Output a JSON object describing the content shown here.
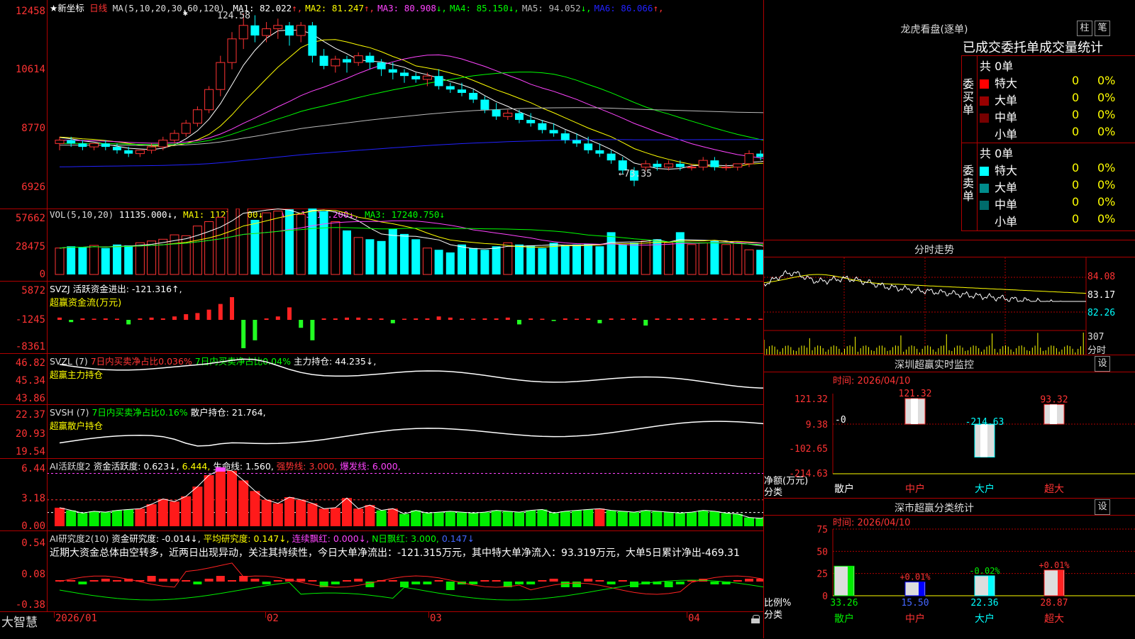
{
  "main": {
    "title": "★新坐标",
    "period": "日线",
    "ma_header": "MA(5,10,20,30,60,120)",
    "ma": [
      {
        "label": "MA1:",
        "value": "82.022",
        "arrow": "↑",
        "color": "#ffffff"
      },
      {
        "label": "MA2:",
        "value": "81.247",
        "arrow": "↑",
        "color": "#ffff00"
      },
      {
        "label": "MA3:",
        "value": "80.908",
        "arrow": "↓",
        "color": "#ff44ff"
      },
      {
        "label": "MA4:",
        "value": "85.150",
        "arrow": "↓",
        "color": "#00ff00"
      },
      {
        "label": "MA5:",
        "value": "94.052",
        "arrow": "↓",
        "color": "#bbbbbb"
      },
      {
        "label": "MA6:",
        "value": "86.066",
        "arrow": "↑",
        "color": "#2222ff"
      }
    ],
    "y_labels": [
      "12458",
      "10614",
      "8770",
      "6926"
    ],
    "high_label": "124.58",
    "low_label": "←73.35",
    "high_marker": "✱"
  },
  "vol": {
    "header": "VOL(5,10,20)",
    "value": "11135.000↓",
    "ma1": "MA1: 11275.600↓",
    "ma2": "MA2: 13115.200↓",
    "ma3": "MA3: 17240.750↓",
    "y_labels": [
      "57662",
      "28475",
      "0"
    ]
  },
  "svzj": {
    "header": "SVZJ  活跃资金进出: -121.316↑,",
    "sub": "超赢资金流(万元)",
    "y_labels": [
      "5872",
      "-1245",
      "-8361"
    ]
  },
  "svzl": {
    "header": "SVZL  (7)",
    "t1": "7日内买卖净占比0.036%",
    "t2": "7日内买卖净占比0.04%",
    "t3": "主力持仓: 44.235↓,",
    "sub": "超赢主力持仓",
    "y_labels": [
      "46.82",
      "45.34",
      "43.86"
    ]
  },
  "svsh": {
    "header": "SVSH  (7)",
    "t1": "7日内买卖净占比0.16%",
    "t2": "散户持仓: 21.764,",
    "sub": "超赢散户持仓",
    "y_labels": [
      "22.37",
      "20.93",
      "19.54"
    ]
  },
  "ai1": {
    "header": "AI活跃度2",
    "t1": "资金活跃度: 0.623↓,",
    "t2": "6.444,",
    "t3": "生命线: 1.560,",
    "t4": "强势线: 3.000,",
    "t5": "爆发线: 6.000,",
    "y_labels": [
      "6.44",
      "3.18",
      "0.00"
    ]
  },
  "ai2": {
    "header": "AI研究度2(10)",
    "t1": "资金研究度: -0.014↓,",
    "t2": "平均研究度: 0.147↓,",
    "t3": "连续飘红: 0.000↓,",
    "t4": "N日飘红: 3.000,",
    "t5": "0.147↓",
    "comment": "近期大资金总体由空转多，近两日出现异动，关注其持续性，今日大单净流出：-121.315万元，其中特大单净流入：93.319万元，大单5日累计净出-469.31",
    "y_labels": [
      "0.54",
      "0.08",
      "-0.38"
    ]
  },
  "xaxis": {
    "brand": "大智慧",
    "labels": [
      "2026/01",
      "02",
      "03",
      "04"
    ]
  },
  "dragon": {
    "title": "龙虎看盘(逐单)",
    "btn1": "柱",
    "btn2": "笔",
    "tabs": "已成交委托单成交量统计",
    "buy_label": "委买单",
    "sell_label": "委卖单",
    "buy_total": "共 0单",
    "sell_total": "共 0单",
    "buy_rows": [
      {
        "name": "特大",
        "color": "#ff0000",
        "count": "0",
        "pct": "0%"
      },
      {
        "name": "大单",
        "color": "#990000",
        "count": "0",
        "pct": "0%"
      },
      {
        "name": "中单",
        "color": "#770000",
        "count": "0",
        "pct": "0%"
      },
      {
        "name": "小单",
        "color": "#000000",
        "count": "0",
        "pct": "0%"
      }
    ],
    "sell_rows": [
      {
        "name": "特大",
        "color": "#00ffff",
        "count": "0",
        "pct": "0%"
      },
      {
        "name": "大单",
        "color": "#008b8b",
        "count": "0",
        "pct": "0%"
      },
      {
        "name": "中单",
        "color": "#006b6b",
        "count": "0",
        "pct": "0%"
      },
      {
        "name": "小单",
        "color": "#000000",
        "count": "0",
        "pct": "0%"
      }
    ]
  },
  "intraday": {
    "title": "分时走势",
    "y_labels": [
      "84.08",
      "83.17",
      "82.26"
    ],
    "vol_label": "307",
    "vol_unit": "分时"
  },
  "monitor": {
    "title": "深圳超赢实时监控",
    "btn": "设",
    "time": "时间: 2026/04/10",
    "y_labels": [
      "121.32",
      "9.38",
      "-102.65",
      "-214.63"
    ],
    "unit1": "净额(万元)",
    "unit2": "分类",
    "zero": "-0",
    "categories": [
      "散户",
      "中户",
      "大户",
      "超大"
    ],
    "values": [
      0,
      121.32,
      -214.63,
      93.32
    ],
    "value_labels": [
      "",
      "121.32",
      "-214.63",
      "93.32"
    ]
  },
  "classify": {
    "title": "深市超赢分类统计",
    "btn": "设",
    "time": "时间: 2026/04/10",
    "y_labels": [
      "75",
      "50",
      "25",
      "0"
    ],
    "unit1": "比例%",
    "unit2": "分类",
    "categories": [
      "散户",
      "中户",
      "大户",
      "超大"
    ],
    "values": [
      33.26,
      15.5,
      22.36,
      28.87
    ],
    "changes": [
      "",
      "+0.01%",
      "-0.02%",
      "+0.01%"
    ]
  },
  "chart_data": {
    "type": "candlestick",
    "title": "★新坐标 日线",
    "y_axis": [
      69.26,
      124.58
    ],
    "candles": [
      [
        86,
        88,
        84,
        87
      ],
      [
        87,
        88,
        85,
        86
      ],
      [
        86,
        87,
        84,
        85
      ],
      [
        85,
        86,
        84,
        86
      ],
      [
        86,
        87,
        84,
        85
      ],
      [
        85,
        86,
        83,
        84
      ],
      [
        84,
        85,
        82,
        83
      ],
      [
        83,
        84,
        82,
        84
      ],
      [
        84,
        86,
        83,
        85
      ],
      [
        85,
        88,
        84,
        87
      ],
      [
        87,
        90,
        86,
        89
      ],
      [
        89,
        93,
        88,
        92
      ],
      [
        92,
        97,
        91,
        96
      ],
      [
        96,
        103,
        95,
        102
      ],
      [
        102,
        112,
        100,
        110
      ],
      [
        110,
        119,
        108,
        117
      ],
      [
        117,
        124.58,
        114,
        121
      ],
      [
        121,
        124,
        116,
        118
      ],
      [
        118,
        122,
        116,
        120
      ],
      [
        120,
        123,
        117,
        121
      ],
      [
        121,
        122,
        115,
        118
      ],
      [
        118,
        122,
        116,
        121
      ],
      [
        121,
        122,
        110,
        112
      ],
      [
        112,
        114,
        108,
        109
      ],
      [
        109,
        112,
        107,
        111
      ],
      [
        111,
        112,
        107,
        110
      ],
      [
        110,
        113,
        109,
        112
      ],
      [
        112,
        113,
        108,
        110
      ],
      [
        110,
        111,
        106,
        108
      ],
      [
        108,
        110,
        105,
        107
      ],
      [
        107,
        108,
        104,
        106
      ],
      [
        106,
        107,
        104,
        105
      ],
      [
        105,
        107,
        103,
        106
      ],
      [
        106,
        108,
        102,
        103
      ],
      [
        103,
        104,
        101,
        102
      ],
      [
        102,
        104,
        100,
        101
      ],
      [
        101,
        102,
        98,
        99
      ],
      [
        99,
        100,
        95,
        96
      ],
      [
        96,
        98,
        93,
        94
      ],
      [
        94,
        96,
        93,
        95
      ],
      [
        95,
        96,
        92,
        93
      ],
      [
        93,
        95,
        91,
        92
      ],
      [
        92,
        93,
        89,
        90
      ],
      [
        90,
        92,
        88,
        89
      ],
      [
        89,
        90,
        86,
        87
      ],
      [
        87,
        89,
        85,
        86
      ],
      [
        86,
        88,
        83,
        84
      ],
      [
        84,
        86,
        82,
        83
      ],
      [
        83,
        84,
        80,
        81
      ],
      [
        81,
        82,
        77,
        78
      ],
      [
        78,
        79,
        73.35,
        75
      ],
      [
        79,
        81,
        78,
        80
      ],
      [
        80,
        81,
        78,
        79
      ],
      [
        79,
        81,
        78,
        80
      ],
      [
        80,
        81,
        78,
        79
      ],
      [
        79,
        80,
        78,
        79
      ],
      [
        79,
        82,
        78,
        81
      ],
      [
        81,
        82,
        78,
        79
      ],
      [
        79,
        80,
        78,
        79
      ],
      [
        79,
        80,
        78,
        80
      ],
      [
        80,
        84,
        79,
        83
      ],
      [
        83,
        84,
        81,
        82
      ],
      [
        82,
        83,
        81,
        82
      ]
    ]
  }
}
